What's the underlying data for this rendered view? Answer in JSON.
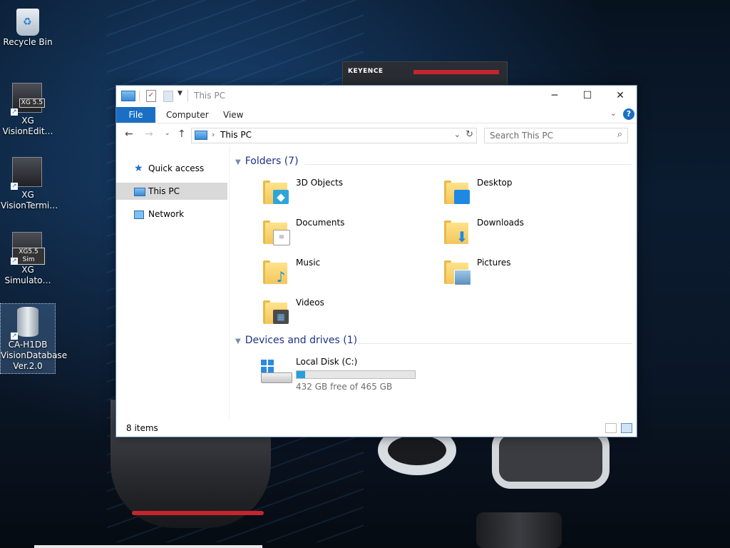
{
  "desktop": {
    "icons": [
      {
        "label": "Recycle Bin"
      },
      {
        "label": "XG VisionEdit…",
        "badge": "XG 5.5"
      },
      {
        "label": "XG VisionTermi…"
      },
      {
        "label": "XG Simulato…",
        "badge": "XG5.5 Sim"
      },
      {
        "label": "CA-H1DB VisionDatabase Ver.2.0"
      }
    ],
    "wallpaper_brand": "KEYENCE"
  },
  "window": {
    "title": "This PC",
    "controls": {
      "minimize": "─",
      "maximize": "☐",
      "close": "✕"
    },
    "ribbon": {
      "tabs": [
        "File",
        "Computer",
        "View"
      ],
      "help": "?"
    },
    "address": {
      "path": "This PC"
    },
    "search": {
      "placeholder": "Search This PC"
    },
    "sidebar": {
      "items": [
        {
          "label": "Quick access",
          "icon": "star-icon"
        },
        {
          "label": "This PC",
          "icon": "pc-icon",
          "active": true
        },
        {
          "label": "Network",
          "icon": "network-icon"
        }
      ]
    },
    "folders": {
      "header": "Folders (7)",
      "items": [
        {
          "label": "3D Objects",
          "icon": "3d-objects-icon",
          "overlay": "#2fa4d8"
        },
        {
          "label": "Desktop",
          "icon": "desktop-icon",
          "overlay": "#1e88e5"
        },
        {
          "label": "Documents",
          "icon": "documents-icon",
          "overlay": "#ffffff"
        },
        {
          "label": "Downloads",
          "icon": "download-arrow-icon",
          "overlay": "#1e88e5"
        },
        {
          "label": "Music",
          "icon": "music-note-icon",
          "overlay": "#1e88e5"
        },
        {
          "label": "Pictures",
          "icon": "pictures-icon",
          "overlay": "#5c8fb8"
        },
        {
          "label": "Videos",
          "icon": "film-icon",
          "overlay": "#4a4a4a"
        }
      ]
    },
    "drives": {
      "header": "Devices and drives (1)",
      "items": [
        {
          "label": "Local Disk (C:)",
          "free_text": "432 GB free of 465 GB",
          "used_fraction": 0.071
        }
      ]
    },
    "status": {
      "items_count": "8 items"
    }
  },
  "colors": {
    "accent": "#1a6fc4",
    "group_header": "#1e3287",
    "drive_fill": "#26a0da",
    "selection": "#d9d9d9"
  }
}
